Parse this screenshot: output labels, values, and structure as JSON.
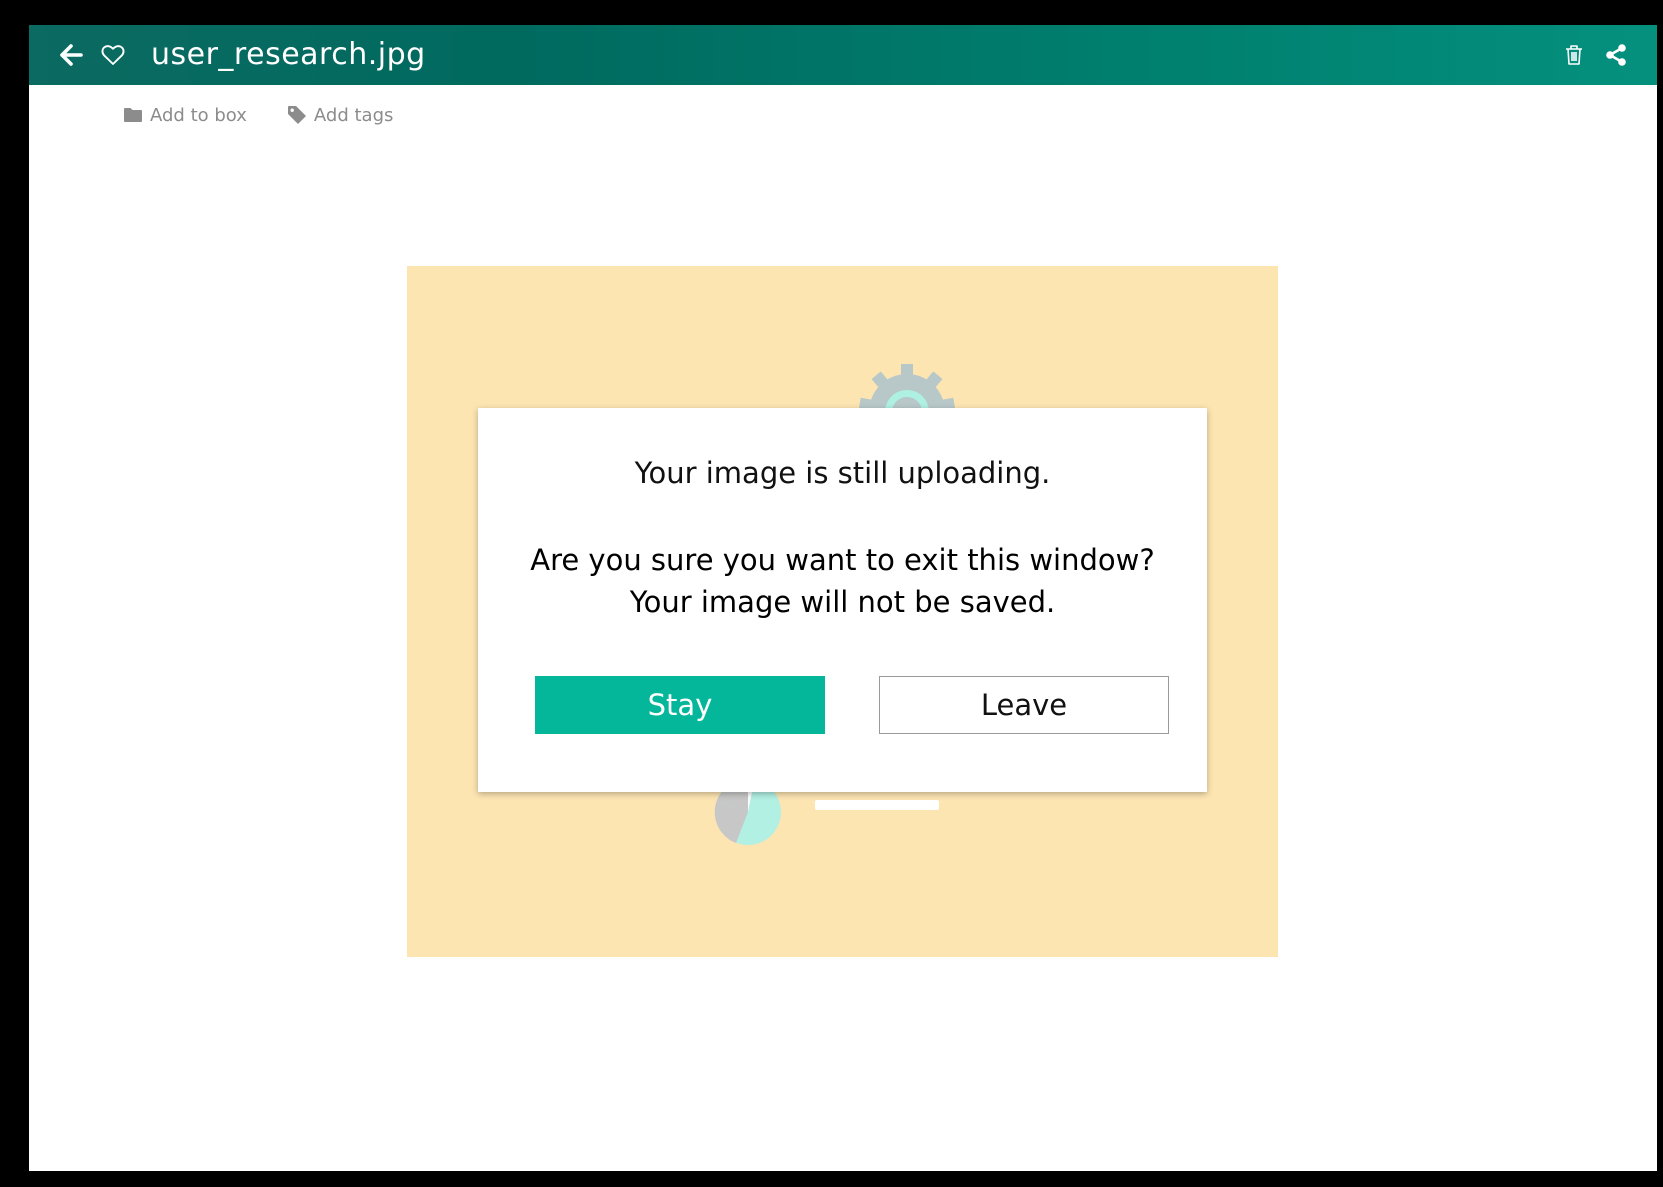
{
  "header": {
    "back_icon": "arrow-left-icon",
    "favorite_icon": "heart-outline-icon",
    "title": "user_research.jpg",
    "delete_icon": "trash-icon",
    "share_icon": "share-icon"
  },
  "toolbar": {
    "add_to_box_label": "Add to box",
    "add_to_box_icon": "folder-icon",
    "add_tags_label": "Add tags",
    "add_tags_icon": "tag-icon"
  },
  "dialog": {
    "message": "Your image is still uploading.",
    "question_line1": "Are you sure you want to exit this window?",
    "question_line2": "Your image will not be saved.",
    "stay_label": "Stay",
    "leave_label": "Leave"
  },
  "colors": {
    "header_gradient_start": "#0b6a61",
    "header_gradient_end": "#05907e",
    "primary_button": "#05b79a",
    "preview_background": "#fde5b2"
  }
}
